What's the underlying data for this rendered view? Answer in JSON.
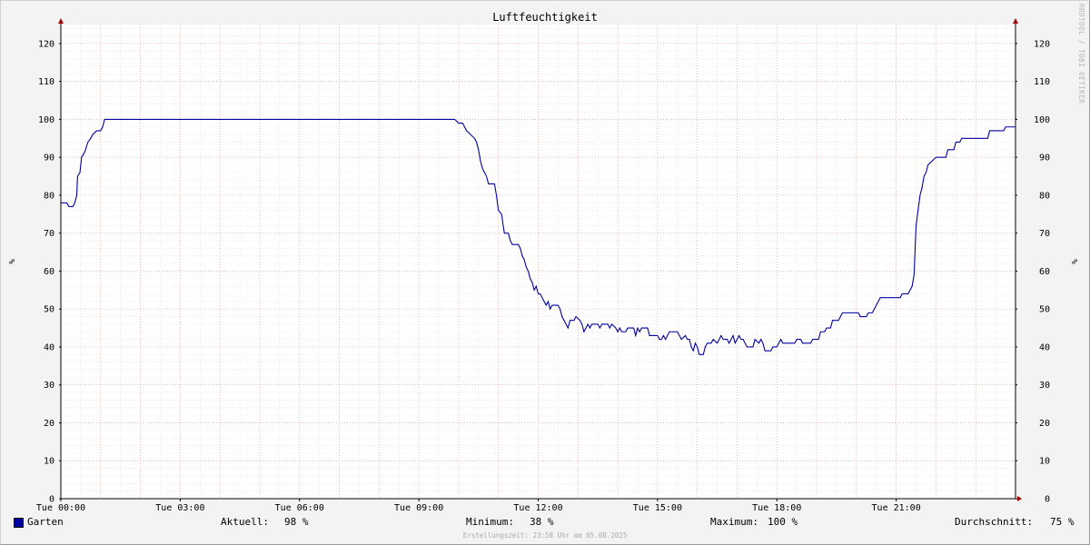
{
  "chart_data": {
    "type": "line",
    "title": "Luftfeuchtigkeit",
    "ylabel": "%",
    "xlabel": "",
    "ylim": [
      0,
      125
    ],
    "xlim_hours": [
      0,
      24
    ],
    "y_ticks": [
      0,
      10,
      20,
      30,
      40,
      50,
      60,
      70,
      80,
      90,
      100,
      110,
      120
    ],
    "x_ticks": [
      {
        "h": 0,
        "label": "Tue 00:00"
      },
      {
        "h": 3,
        "label": "Tue 03:00"
      },
      {
        "h": 6,
        "label": "Tue 06:00"
      },
      {
        "h": 9,
        "label": "Tue 09:00"
      },
      {
        "h": 12,
        "label": "Tue 12:00"
      },
      {
        "h": 15,
        "label": "Tue 15:00"
      },
      {
        "h": 18,
        "label": "Tue 18:00"
      },
      {
        "h": 21,
        "label": "Tue 21:00"
      }
    ],
    "grid": true,
    "series": [
      {
        "name": "Garten",
        "color": "#0000a0",
        "points": [
          [
            0.0,
            78
          ],
          [
            0.15,
            78
          ],
          [
            0.2,
            77
          ],
          [
            0.3,
            77
          ],
          [
            0.35,
            78
          ],
          [
            0.4,
            80
          ],
          [
            0.42,
            85
          ],
          [
            0.48,
            86
          ],
          [
            0.52,
            90
          ],
          [
            0.58,
            91
          ],
          [
            0.62,
            92
          ],
          [
            0.68,
            94
          ],
          [
            0.75,
            95
          ],
          [
            0.8,
            96
          ],
          [
            0.9,
            97
          ],
          [
            1.0,
            97
          ],
          [
            1.05,
            98
          ],
          [
            1.1,
            100
          ],
          [
            9.9,
            100
          ],
          [
            10.0,
            99
          ],
          [
            10.1,
            99
          ],
          [
            10.15,
            98
          ],
          [
            10.2,
            97
          ],
          [
            10.3,
            96
          ],
          [
            10.4,
            95
          ],
          [
            10.45,
            94
          ],
          [
            10.5,
            92
          ],
          [
            10.55,
            89
          ],
          [
            10.6,
            87
          ],
          [
            10.7,
            85
          ],
          [
            10.75,
            83
          ],
          [
            10.9,
            83
          ],
          [
            10.95,
            80
          ],
          [
            11.0,
            76
          ],
          [
            11.08,
            75
          ],
          [
            11.12,
            72
          ],
          [
            11.15,
            70
          ],
          [
            11.25,
            70
          ],
          [
            11.3,
            68
          ],
          [
            11.35,
            67
          ],
          [
            11.5,
            67
          ],
          [
            11.55,
            66
          ],
          [
            11.6,
            64
          ],
          [
            11.65,
            63
          ],
          [
            11.7,
            61
          ],
          [
            11.75,
            60
          ],
          [
            11.8,
            58
          ],
          [
            11.85,
            57
          ],
          [
            11.9,
            55
          ],
          [
            11.95,
            56
          ],
          [
            12.0,
            54
          ],
          [
            12.05,
            54
          ],
          [
            12.1,
            53
          ],
          [
            12.15,
            52
          ],
          [
            12.2,
            51
          ],
          [
            12.25,
            52
          ],
          [
            12.3,
            50
          ],
          [
            12.35,
            51
          ],
          [
            12.5,
            51
          ],
          [
            12.55,
            50
          ],
          [
            12.6,
            48
          ],
          [
            12.65,
            47
          ],
          [
            12.7,
            46
          ],
          [
            12.75,
            45
          ],
          [
            12.8,
            47
          ],
          [
            12.9,
            47
          ],
          [
            12.95,
            48
          ],
          [
            13.05,
            47
          ],
          [
            13.1,
            46
          ],
          [
            13.15,
            44
          ],
          [
            13.2,
            45
          ],
          [
            13.25,
            46
          ],
          [
            13.3,
            45
          ],
          [
            13.35,
            46
          ],
          [
            13.5,
            46
          ],
          [
            13.55,
            45
          ],
          [
            13.6,
            46
          ],
          [
            13.75,
            46
          ],
          [
            13.8,
            45
          ],
          [
            13.85,
            46
          ],
          [
            13.95,
            45
          ],
          [
            14.0,
            44
          ],
          [
            14.05,
            45
          ],
          [
            14.1,
            44
          ],
          [
            14.2,
            44
          ],
          [
            14.25,
            45
          ],
          [
            14.4,
            45
          ],
          [
            14.45,
            43
          ],
          [
            14.5,
            45
          ],
          [
            14.55,
            44
          ],
          [
            14.6,
            45
          ],
          [
            14.75,
            45
          ],
          [
            14.8,
            43
          ],
          [
            15.0,
            43
          ],
          [
            15.05,
            42
          ],
          [
            15.1,
            42
          ],
          [
            15.15,
            43
          ],
          [
            15.2,
            42
          ],
          [
            15.3,
            44
          ],
          [
            15.5,
            44
          ],
          [
            15.55,
            43
          ],
          [
            15.6,
            42
          ],
          [
            15.7,
            43
          ],
          [
            15.75,
            42
          ],
          [
            15.8,
            42
          ],
          [
            15.85,
            40
          ],
          [
            15.9,
            39
          ],
          [
            15.95,
            41
          ],
          [
            16.0,
            40
          ],
          [
            16.05,
            38
          ],
          [
            16.15,
            38
          ],
          [
            16.2,
            40
          ],
          [
            16.25,
            41
          ],
          [
            16.35,
            41
          ],
          [
            16.4,
            42
          ],
          [
            16.5,
            41
          ],
          [
            16.55,
            42
          ],
          [
            16.6,
            43
          ],
          [
            16.65,
            42
          ],
          [
            16.75,
            42
          ],
          [
            16.8,
            41
          ],
          [
            16.85,
            42
          ],
          [
            16.9,
            43
          ],
          [
            16.95,
            41
          ],
          [
            17.0,
            42
          ],
          [
            17.05,
            43
          ],
          [
            17.1,
            42
          ],
          [
            17.15,
            42
          ],
          [
            17.2,
            41
          ],
          [
            17.25,
            40
          ],
          [
            17.4,
            40
          ],
          [
            17.45,
            42
          ],
          [
            17.55,
            41
          ],
          [
            17.6,
            42
          ],
          [
            17.65,
            41
          ],
          [
            17.7,
            39
          ],
          [
            17.85,
            39
          ],
          [
            17.9,
            40
          ],
          [
            18.0,
            40
          ],
          [
            18.05,
            41
          ],
          [
            18.1,
            42
          ],
          [
            18.15,
            41
          ],
          [
            18.45,
            41
          ],
          [
            18.5,
            42
          ],
          [
            18.6,
            42
          ],
          [
            18.65,
            41
          ],
          [
            18.85,
            41
          ],
          [
            18.9,
            42
          ],
          [
            19.05,
            42
          ],
          [
            19.1,
            44
          ],
          [
            19.2,
            44
          ],
          [
            19.25,
            45
          ],
          [
            19.35,
            45
          ],
          [
            19.4,
            47
          ],
          [
            19.55,
            47
          ],
          [
            19.6,
            48
          ],
          [
            19.65,
            49
          ],
          [
            20.05,
            49
          ],
          [
            20.1,
            48
          ],
          [
            20.25,
            48
          ],
          [
            20.3,
            49
          ],
          [
            20.4,
            49
          ],
          [
            20.45,
            50
          ],
          [
            20.5,
            51
          ],
          [
            20.55,
            52
          ],
          [
            20.6,
            53
          ],
          [
            21.1,
            53
          ],
          [
            21.15,
            54
          ],
          [
            21.3,
            54
          ],
          [
            21.35,
            55
          ],
          [
            21.4,
            56
          ],
          [
            21.45,
            59
          ],
          [
            21.5,
            72
          ],
          [
            21.55,
            76
          ],
          [
            21.6,
            80
          ],
          [
            21.65,
            82
          ],
          [
            21.7,
            85
          ],
          [
            21.75,
            86
          ],
          [
            21.8,
            88
          ],
          [
            21.9,
            89
          ],
          [
            22.0,
            90
          ],
          [
            22.25,
            90
          ],
          [
            22.3,
            92
          ],
          [
            22.45,
            92
          ],
          [
            22.5,
            94
          ],
          [
            22.6,
            94
          ],
          [
            22.65,
            95
          ],
          [
            23.3,
            95
          ],
          [
            23.35,
            97
          ],
          [
            23.7,
            97
          ],
          [
            23.75,
            98
          ],
          [
            24.0,
            98
          ]
        ]
      }
    ]
  },
  "legend": {
    "series_name": "Garten",
    "color": "#0000a0",
    "aktuell_label": "Aktuell:",
    "aktuell_value": "98 %",
    "minimum_label": "Minimum:",
    "minimum_value": "38 %",
    "maximum_label": "Maximum:",
    "maximum_value": "100 %",
    "durchschnitt_label": "Durchschnitt:",
    "durchschnitt_value": "75 %"
  },
  "footer_text": "Erstellungszeit: 23:58 Uhr am 05.08.2025",
  "watermark_text": "RRDTOOL / TOBI OETIKER"
}
